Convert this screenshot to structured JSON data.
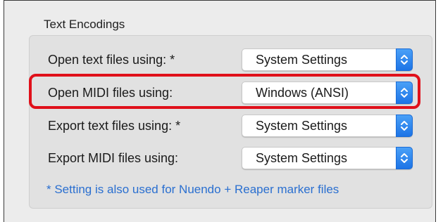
{
  "group": {
    "title": "Text Encodings"
  },
  "settings": [
    {
      "label": "Open text files using: *",
      "value": "System Settings"
    },
    {
      "label": "Open MIDI files using:",
      "value": "Windows (ANSI)"
    },
    {
      "label": "Export text files using: *",
      "value": "System Settings"
    },
    {
      "label": "Export MIDI files using:",
      "value": "System Settings"
    }
  ],
  "footnote": "* Setting is also used for Nuendo + Reaper marker files",
  "colors": {
    "highlight": "#e0101a",
    "stepper_blue": "#1d74e6",
    "footnote_blue": "#2a6fd0"
  },
  "icons": {
    "stepper": "chevron-updown-icon"
  }
}
